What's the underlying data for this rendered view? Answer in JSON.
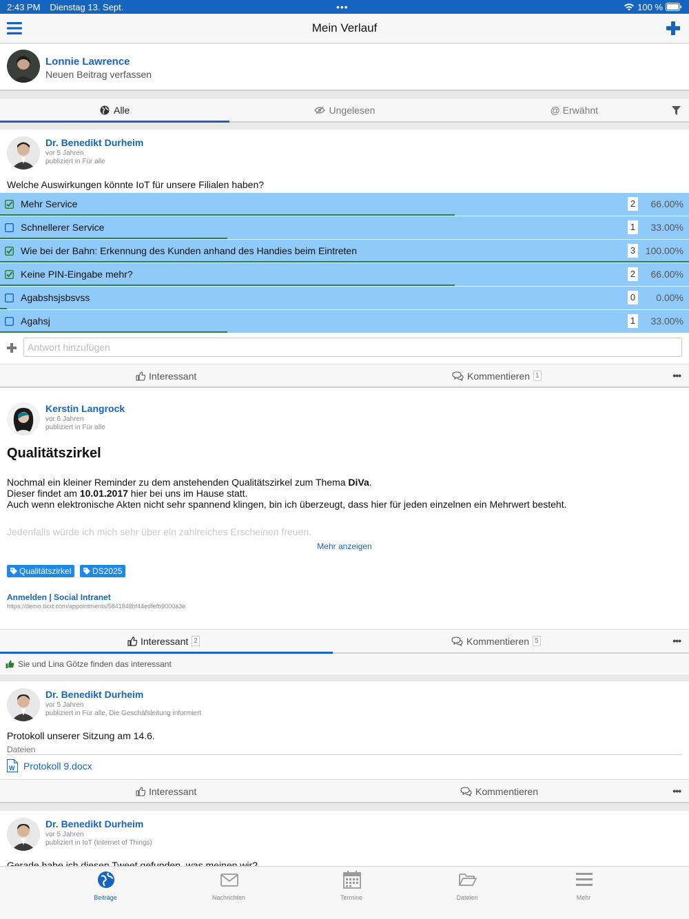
{
  "status": {
    "time": "2:43 PM",
    "date": "Dienstag 13. Sept.",
    "battery": "100 %"
  },
  "nav": {
    "title": "Mein Verlauf"
  },
  "composer": {
    "user": "Lonnie Lawrence",
    "prompt": "Neuen Beitrag verfassen"
  },
  "filter_tabs": [
    {
      "label": "Alle",
      "icon": "globe-icon",
      "active": true
    },
    {
      "label": "Ungelesen",
      "icon": "eye-slash-icon"
    },
    {
      "label": "@ Erwähnt",
      "icon": "at-icon"
    }
  ],
  "posts": [
    {
      "author": "Dr. Benedikt Durheim",
      "time": "vor 5 Jahren",
      "published": "publiziert in Für alle",
      "question": "Welche Auswirkungen könnte IoT für unsere Filialen haben?",
      "poll": [
        {
          "option": "Mehr Service",
          "checked": true,
          "count": "2",
          "percent": "66.00%",
          "fraction": 0.66
        },
        {
          "option": "Schnellerer Service",
          "checked": false,
          "count": "1",
          "percent": "33.00%",
          "fraction": 0.33
        },
        {
          "option": "Wie bei der Bahn: Erkennung des Kunden anhand des Handies beim Eintreten",
          "checked": true,
          "count": "3",
          "percent": "100.00%",
          "fraction": 1.0
        },
        {
          "option": "Keine PIN-Eingabe mehr?",
          "checked": true,
          "count": "2",
          "percent": "66.00%",
          "fraction": 0.66
        },
        {
          "option": "Agabshsjsbsvss",
          "checked": false,
          "count": "0",
          "percent": "0.00%",
          "fraction": 0.0
        },
        {
          "option": "Agahsj",
          "checked": false,
          "count": "1",
          "percent": "33.00%",
          "fraction": 0.33
        }
      ],
      "answer_placeholder": "Antwort hinzufügen",
      "like_label": "Interessant",
      "comment_label": "Kommentieren",
      "comment_count": "1"
    },
    {
      "author": "Kerstin Langrock",
      "time": "vor 6 Jahren",
      "published": "publiziert in Für alle",
      "title": "Qualitätszirkel",
      "body_1a": "Nochmal ein kleiner Reminder zu dem anstehenden Qualitätszirkel zum Thema ",
      "body_1b": "DiVa",
      "body_1c": ".",
      "body_2a": "Dieser findet am ",
      "body_2b": "10.01.2017",
      "body_2c": " hier bei uns im Hause statt.",
      "body_3": "Auch wenn elektronische Akten nicht sehr spannend klingen, bin ich überzeugt, dass hier für jeden einzelnen ein Mehrwert besteht.",
      "body_4": "Jedenfalls würde ich mich sehr über ein zahlreiches Erscheinen freuen.",
      "more": "Mehr anzeigen",
      "tags": [
        "Qualitätszirkel",
        "DS2025"
      ],
      "link_title": "Anmelden | Social Intranet",
      "link_url": "https://demo.tixxt.com/appointments/5841848bf44edfefb9000a3e",
      "like_label": "Interessant",
      "like_count": "2",
      "comment_label": "Kommentieren",
      "comment_count": "5",
      "likers": "Sie und Lina Götze finden das interessant"
    },
    {
      "author": "Dr. Benedikt Durheim",
      "time": "vor 5 Jahren",
      "published": "publiziert in Für alle, Die Geschäfsleitung informiert",
      "text": "Protokoll unserer Sitzung am 14.6.",
      "files_label": "Dateien",
      "file_name": "Protokoll 9.docx",
      "like_label": "Interessant",
      "comment_label": "Kommentieren"
    },
    {
      "author": "Dr. Benedikt Durheim",
      "time": "vor 5 Jahren",
      "published": "publiziert in IoT (Internet of Things)",
      "text": "Gerade habe ich diesen Tweet gefunden, was meinen wir?"
    }
  ],
  "tabbar": [
    {
      "label": "Beiträge",
      "icon": "globe-icon",
      "active": true
    },
    {
      "label": "Nachrichten",
      "icon": "envelope-icon"
    },
    {
      "label": "Termine",
      "icon": "calendar-icon"
    },
    {
      "label": "Dateien",
      "icon": "folder-open-icon"
    },
    {
      "label": "Mehr",
      "icon": "menu-icon"
    }
  ],
  "colors": {
    "accent": "#1565c0",
    "poll_bg": "#90caf9",
    "poll_bar": "#2e7d32",
    "tag": "#1e88e5"
  }
}
